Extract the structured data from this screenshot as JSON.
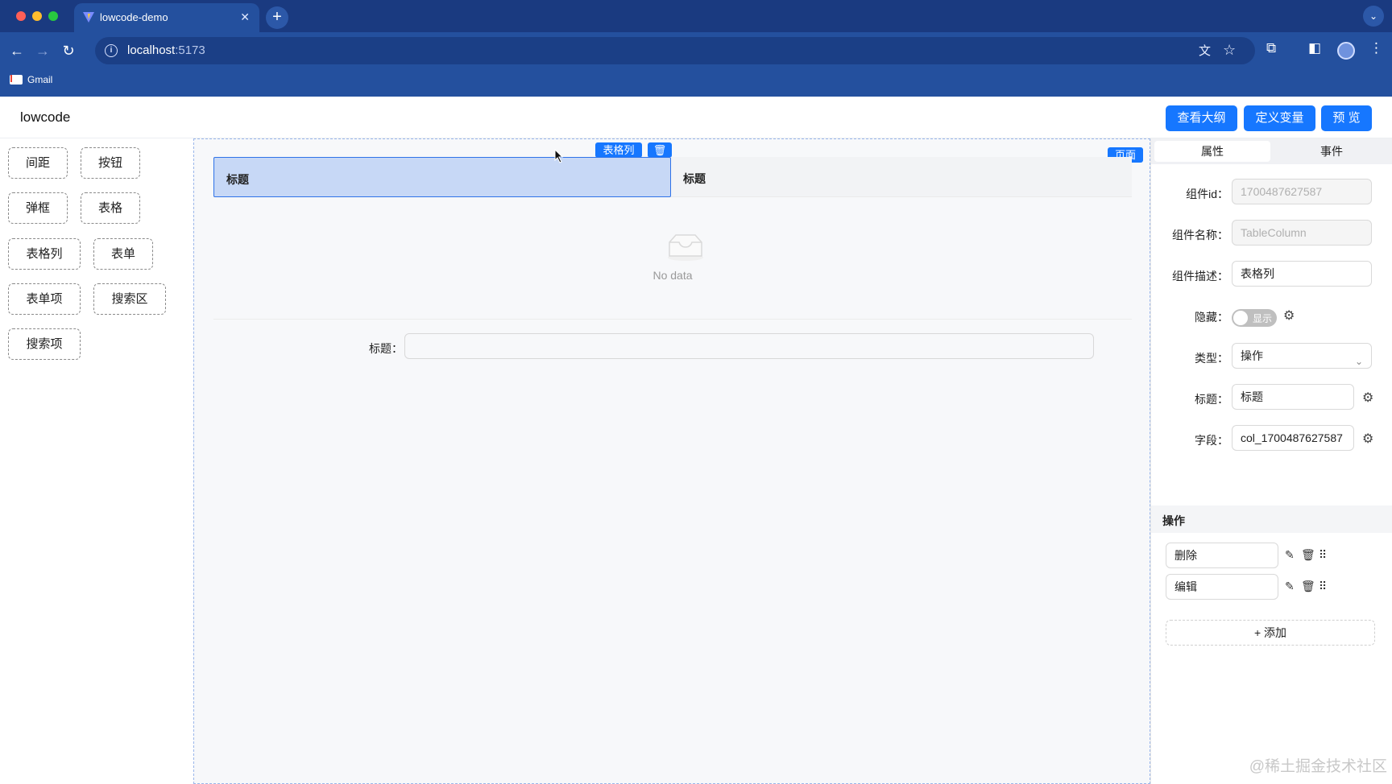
{
  "browser": {
    "tab_title": "lowcode-demo",
    "new_tab": "+",
    "url_host": "localhost",
    "url_port": ":5173",
    "bookmark_gmail": "Gmail"
  },
  "app": {
    "title": "lowcode",
    "header_buttons": [
      "查看大纲",
      "定义变量",
      "预 览"
    ]
  },
  "components": [
    "间距",
    "按钮",
    "弹框",
    "表格",
    "表格列",
    "表单",
    "表单项",
    "搜索区",
    "搜索项"
  ],
  "canvas": {
    "selected_tag": "表格列",
    "page_tag": "页面",
    "table_columns": [
      "标题",
      "标题"
    ],
    "empty_text": "No data",
    "form_label": "标题："
  },
  "panel": {
    "tabs": [
      "属性",
      "事件"
    ],
    "fields": {
      "id_label": "组件id：",
      "id_value": "1700487627587",
      "name_label": "组件名称：",
      "name_value": "TableColumn",
      "desc_label": "组件描述：",
      "desc_value": "表格列",
      "hidden_label": "隐藏：",
      "hidden_switch": "显示",
      "type_label": "类型：",
      "type_value": "操作",
      "title_label": "标题：",
      "title_value": "标题",
      "field_label": "字段：",
      "field_value": "col_1700487627587"
    },
    "ops_section": "操作",
    "ops": [
      "删除",
      "编辑"
    ],
    "add_label": "+ 添加"
  },
  "watermark": "@稀土掘金技术社区",
  "colors": {
    "primary": "#1677ff",
    "chrome": "#24509e"
  }
}
